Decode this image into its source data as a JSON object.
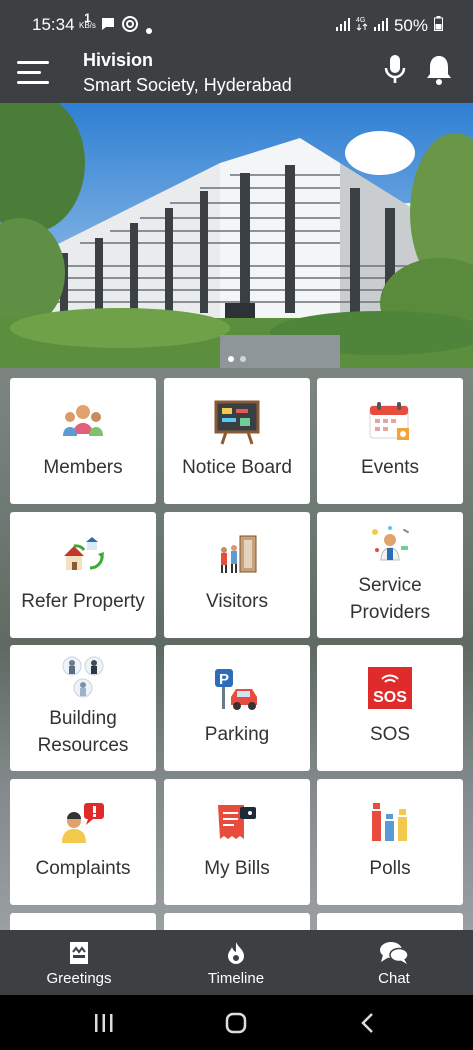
{
  "status_bar": {
    "time": "15:34",
    "net_speed_value": "1",
    "net_speed_unit": "KB/s",
    "battery": "50%"
  },
  "header": {
    "title": "Hivision",
    "subtitle": "Smart Society, Hyderabad"
  },
  "banner": {
    "total_slides": 3,
    "active_slide": 1
  },
  "tiles": [
    {
      "label": "Members",
      "icon": "members-icon"
    },
    {
      "label": "Notice Board",
      "icon": "notice-board-icon"
    },
    {
      "label": "Events",
      "icon": "events-calendar-icon"
    },
    {
      "label": "Refer Property",
      "icon": "refer-property-icon"
    },
    {
      "label": "Visitors",
      "icon": "visitors-icon"
    },
    {
      "label": "Service Providers",
      "line1": "Service",
      "line2": "Providers",
      "icon": "service-providers-icon"
    },
    {
      "label": "Building Resources",
      "line1": "Building",
      "line2": "Resources",
      "icon": "building-resources-icon"
    },
    {
      "label": "Parking",
      "icon": "parking-icon"
    },
    {
      "label": "SOS",
      "icon": "sos-icon",
      "icon_text": "SOS"
    },
    {
      "label": "Complaints",
      "icon": "complaints-icon"
    },
    {
      "label": "My Bills",
      "icon": "bills-icon"
    },
    {
      "label": "Polls",
      "icon": "polls-icon"
    }
  ],
  "bottom_nav": [
    {
      "label": "Greetings",
      "icon": "greetings-icon"
    },
    {
      "label": "Timeline",
      "icon": "timeline-flame-icon"
    },
    {
      "label": "Chat",
      "icon": "chat-bubbles-icon"
    }
  ],
  "colors": {
    "bar": "#3d4043",
    "tile_bg": "#ffffff",
    "sos_red": "#e02b2b"
  }
}
